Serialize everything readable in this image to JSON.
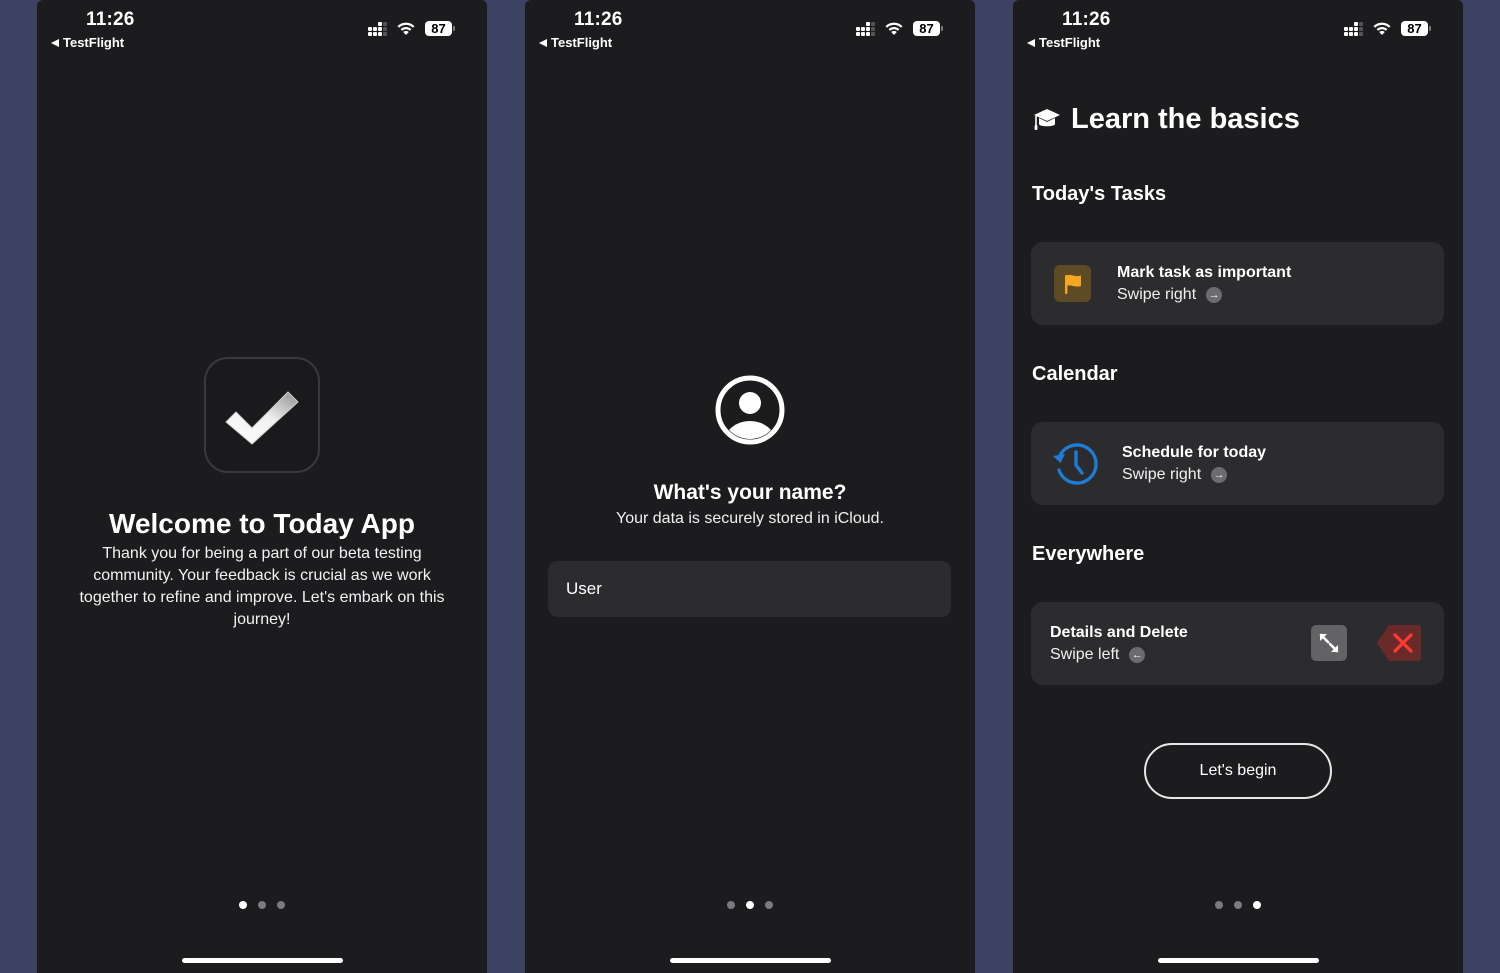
{
  "status_bar": {
    "time": "11:26",
    "back_label": "TestFlight",
    "battery": "87",
    "icons": [
      "back-triangle-icon",
      "cellular-signal-icon",
      "wifi-icon",
      "battery-icon"
    ]
  },
  "screens": [
    {
      "icon": "checkmark-icon",
      "title": "Welcome to Today App",
      "body": "Thank you for being a part of our beta testing community. Your feedback is crucial as we work together to refine and improve. Let's embark on this journey!",
      "page_index": 1,
      "page_count": 3
    },
    {
      "icon": "person-circle-icon",
      "title": "What's your name?",
      "subtitle": "Your data is securely stored in iCloud.",
      "name_input_value": "User",
      "page_index": 2,
      "page_count": 3
    },
    {
      "icon": "graduation-cap-icon",
      "title": "Learn the basics",
      "sections": [
        {
          "title": "Today's Tasks",
          "card": {
            "icon": "flag-icon",
            "title": "Mark task as important",
            "gesture": "Swipe right",
            "gesture_icon": "arrow-right-circle-icon",
            "accent": "#f5a623"
          }
        },
        {
          "title": "Calendar",
          "card": {
            "icon": "clock-history-icon",
            "title": "Schedule for today",
            "gesture": "Swipe right",
            "gesture_icon": "arrow-right-circle-icon",
            "accent": "#1e7bd6"
          }
        },
        {
          "title": "Everywhere",
          "card": {
            "title": "Details and Delete",
            "gesture": "Swipe left",
            "gesture_icon": "arrow-left-circle-icon",
            "action_icons": [
              "expand-arrows-icon",
              "delete-x-icon"
            ],
            "accent": "#ff3b30"
          }
        }
      ],
      "begin_button": "Let's begin",
      "page_index": 3,
      "page_count": 3
    }
  ],
  "arrows": {
    "right": "→",
    "left": "←"
  }
}
